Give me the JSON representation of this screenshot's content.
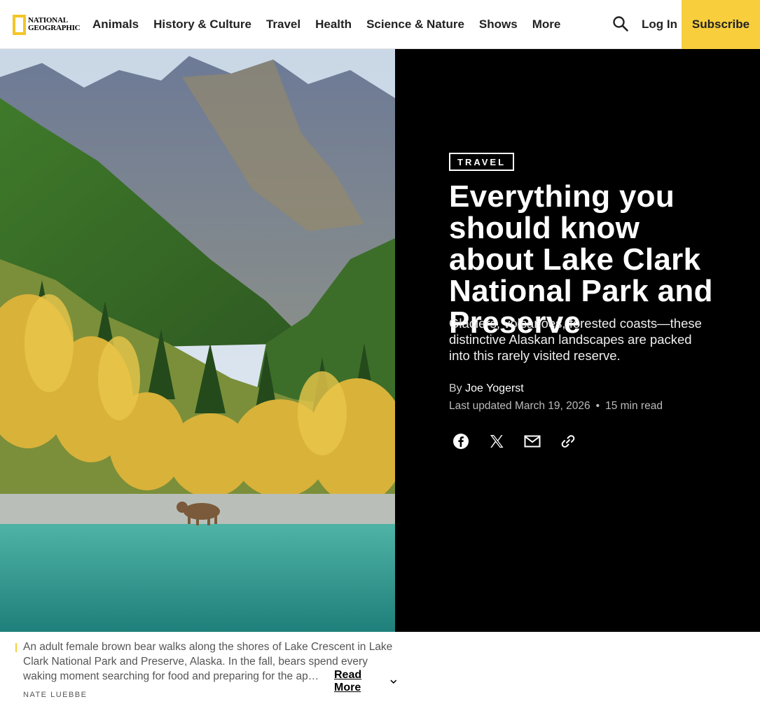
{
  "header": {
    "logo_line1": "NATIONAL",
    "logo_line2": "GEOGRAPHIC",
    "nav": [
      "Animals",
      "History & Culture",
      "Travel",
      "Health",
      "Science & Nature",
      "Shows",
      "More"
    ],
    "login_label": "Log In",
    "subscribe_label": "Subscribe",
    "search_icon": "search-icon"
  },
  "article": {
    "tag": "TRAVEL",
    "title": "Everything you should know about Lake Clark National Park and Preserve",
    "dek": "Glaciers, volcanoes, forested coasts—these distinctive Alaskan landscapes are packed into this rarely visited reserve.",
    "byline_prefix": "By",
    "author": "Joe Yogerst",
    "updated": "Last updated March 19, 2026",
    "separator": "•",
    "read_time": "15 min read",
    "share_icons": [
      "facebook-icon",
      "x-icon",
      "email-icon",
      "link-icon"
    ]
  },
  "caption": {
    "text": "An adult female brown bear walks along the shores of Lake Crescent in Lake Clark National Park and Preserve, Alaska. In the fall, bears spend every waking moment searching for food and preparing for the ap…",
    "read_more": "Read More",
    "credit": "NATE LUEBBE"
  },
  "colors": {
    "brand_yellow": "#f8ce3d",
    "hero_panel": "#000000"
  }
}
